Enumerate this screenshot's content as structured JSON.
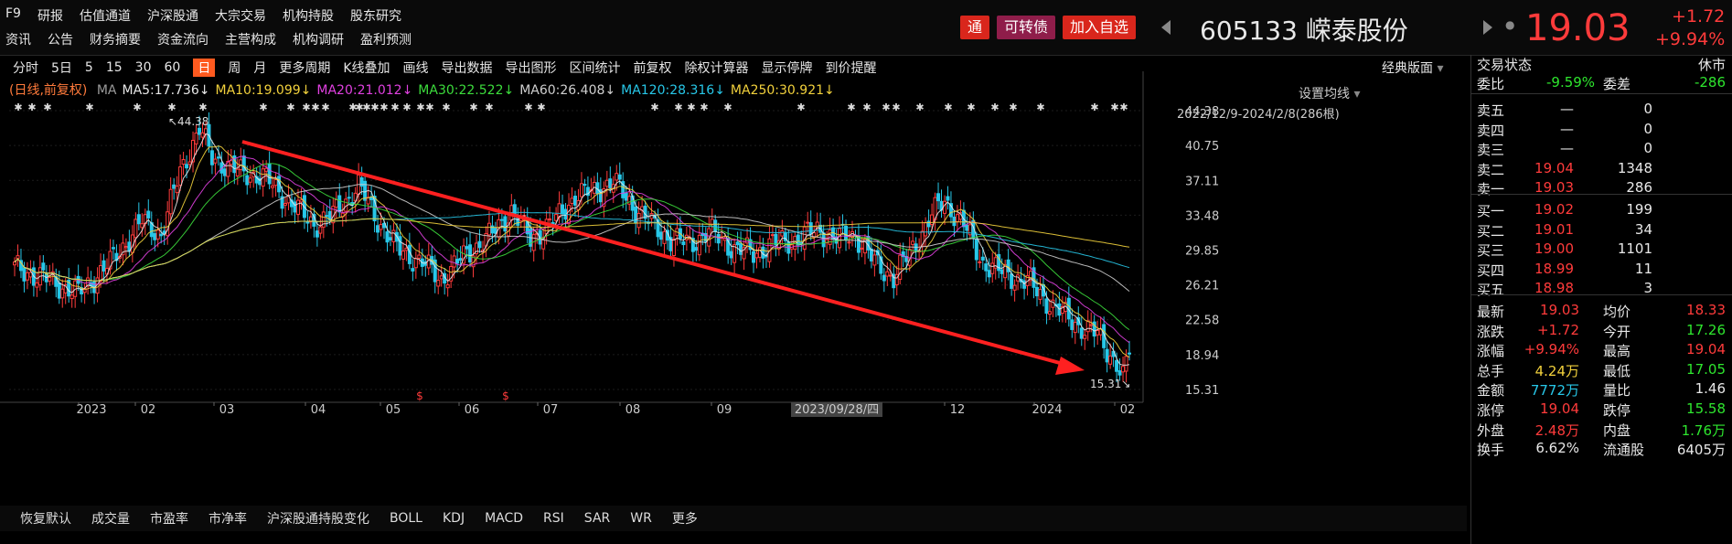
{
  "menu_top": [
    "F9",
    "研报",
    "估值通道",
    "沪深股通",
    "大宗交易",
    "机构持股",
    "股东研究"
  ],
  "menu_bottom": [
    "资讯",
    "公告",
    "财务摘要",
    "资金流向",
    "主营构成",
    "机构调研",
    "盈利预测"
  ],
  "badges": [
    {
      "label": "通",
      "color": "#d9261c"
    },
    {
      "label": "可转债",
      "color": "#8f1d4a"
    },
    {
      "label": "加入自选",
      "color": "#d9261c"
    }
  ],
  "stock": {
    "code": "605133",
    "name": "嵘泰股份",
    "price": "19.03",
    "change": "+1.72",
    "pct": "+9.94%"
  },
  "toolbar": [
    "分时",
    "5日",
    "5",
    "15",
    "30",
    "60",
    "日",
    "周",
    "月",
    "更多周期",
    "K线叠加",
    "画线",
    "导出数据",
    "导出图形",
    "区间统计",
    "前复权",
    "除权计算器",
    "显示停牌",
    "到价提醒"
  ],
  "toolbar_selected": "日",
  "classic_label": "经典版面",
  "ma_header": "(日线,前复权)",
  "ma_items": [
    {
      "label": "MA",
      "color": "#9a9a9a"
    },
    {
      "label": "MA5:17.736↓",
      "color": "#e8e8e8"
    },
    {
      "label": "MA10:19.099↓",
      "color": "#f2d13c"
    },
    {
      "label": "MA20:21.012↓",
      "color": "#e040e0"
    },
    {
      "label": "MA30:22.522↓",
      "color": "#3cdc3c"
    },
    {
      "label": "MA60:26.408↓",
      "color": "#cfcfcf"
    },
    {
      "label": "MA120:28.316↓",
      "color": "#27c7e8"
    },
    {
      "label": "MA250:30.921↓",
      "color": "#f2d13c"
    }
  ],
  "settings_label": "设置均线",
  "range_label": "2022/12/9-2024/2/8(286根)",
  "chart_data": {
    "type": "candlestick",
    "y_ticks": [
      "44.38",
      "40.75",
      "37.11",
      "33.48",
      "29.85",
      "26.21",
      "22.58",
      "18.94",
      "15.31"
    ],
    "ylim": [
      15.31,
      44.38
    ],
    "x_ticks": [
      "2023",
      "02",
      "03",
      "04",
      "05",
      "06",
      "07",
      "08",
      "09",
      "2023/09/28/四",
      "12",
      "2024",
      "02"
    ],
    "annotations": {
      "high": "44.38",
      "low": "15.31"
    },
    "closes_anchor": [
      [
        0,
        28.0
      ],
      [
        10,
        26.8
      ],
      [
        20,
        25.3
      ],
      [
        30,
        28.5
      ],
      [
        40,
        32.8
      ],
      [
        46,
        31.5
      ],
      [
        52,
        38.0
      ],
      [
        58,
        42.5
      ],
      [
        62,
        39.5
      ],
      [
        70,
        38.0
      ],
      [
        78,
        37.5
      ],
      [
        86,
        35.0
      ],
      [
        94,
        32.5
      ],
      [
        100,
        33.5
      ],
      [
        108,
        36.5
      ],
      [
        114,
        33.0
      ],
      [
        120,
        30.0
      ],
      [
        128,
        28.5
      ],
      [
        134,
        26.8
      ],
      [
        142,
        29.5
      ],
      [
        150,
        31.5
      ],
      [
        156,
        34.0
      ],
      [
        162,
        31.0
      ],
      [
        170,
        33.0
      ],
      [
        176,
        35.5
      ],
      [
        182,
        36.0
      ],
      [
        188,
        37.0
      ],
      [
        194,
        34.5
      ],
      [
        200,
        32.5
      ],
      [
        206,
        31.0
      ],
      [
        212,
        30.5
      ],
      [
        218,
        31.8
      ],
      [
        226,
        30.0
      ],
      [
        232,
        29.5
      ],
      [
        238,
        30.5
      ],
      [
        246,
        31.0
      ],
      [
        252,
        32.0
      ],
      [
        258,
        31.0
      ],
      [
        264,
        31.5
      ],
      [
        270,
        28.5
      ],
      [
        276,
        27.0
      ],
      [
        282,
        30.0
      ],
      [
        288,
        33.5
      ],
      [
        292,
        35.0
      ],
      [
        298,
        32.5
      ],
      [
        304,
        28.5
      ],
      [
        310,
        27.5
      ],
      [
        318,
        26.5
      ],
      [
        326,
        24.0
      ],
      [
        334,
        22.0
      ],
      [
        340,
        21.0
      ],
      [
        346,
        18.0
      ],
      [
        348,
        16.5
      ],
      [
        350,
        19.03
      ]
    ]
  },
  "bottom_tabs": [
    "恢复默认",
    "成交量",
    "市盈率",
    "市净率",
    "沪深股通持股变化",
    "BOLL",
    "KDJ",
    "MACD",
    "RSI",
    "SAR",
    "WR",
    "更多"
  ],
  "panel": {
    "status_label": "交易状态",
    "status_value": "休市",
    "weibi_label": "委比",
    "weibi_value": "-9.59%",
    "weicha_label": "委差",
    "weicha_value": "-286",
    "sells": [
      {
        "label": "卖五",
        "price": "—",
        "vol": "0"
      },
      {
        "label": "卖四",
        "price": "—",
        "vol": "0"
      },
      {
        "label": "卖三",
        "price": "—",
        "vol": "0"
      },
      {
        "label": "卖二",
        "price": "19.04",
        "vol": "1348"
      },
      {
        "label": "卖一",
        "price": "19.03",
        "vol": "286"
      }
    ],
    "buys": [
      {
        "label": "买一",
        "price": "19.02",
        "vol": "199"
      },
      {
        "label": "买二",
        "price": "19.01",
        "vol": "34"
      },
      {
        "label": "买三",
        "price": "19.00",
        "vol": "1101"
      },
      {
        "label": "买四",
        "price": "18.99",
        "vol": "11"
      },
      {
        "label": "买五",
        "price": "18.98",
        "vol": "3"
      }
    ],
    "stats": [
      {
        "l1": "最新",
        "v1": "19.03",
        "c1": "red",
        "l2": "均价",
        "v2": "18.33",
        "c2": "red"
      },
      {
        "l1": "涨跌",
        "v1": "+1.72",
        "c1": "red",
        "l2": "今开",
        "v2": "17.26",
        "c2": "green"
      },
      {
        "l1": "涨幅",
        "v1": "+9.94%",
        "c1": "red",
        "l2": "最高",
        "v2": "19.04",
        "c2": "red"
      },
      {
        "l1": "总手",
        "v1": "4.24万",
        "c1": "yel",
        "l2": "最低",
        "v2": "17.05",
        "c2": "green"
      },
      {
        "l1": "金额",
        "v1": "7772万",
        "c1": "cyan",
        "l2": "量比",
        "v2": "1.46",
        "c2": "white"
      },
      {
        "l1": "涨停",
        "v1": "19.04",
        "c1": "red",
        "l2": "跌停",
        "v2": "15.58",
        "c2": "green"
      },
      {
        "l1": "外盘",
        "v1": "2.48万",
        "c1": "red",
        "l2": "内盘",
        "v2": "1.76万",
        "c2": "green"
      },
      {
        "l1": "换手",
        "v1": "6.62%",
        "c1": "white",
        "l2": "流通股",
        "v2": "6405万",
        "c2": "white"
      }
    ]
  }
}
